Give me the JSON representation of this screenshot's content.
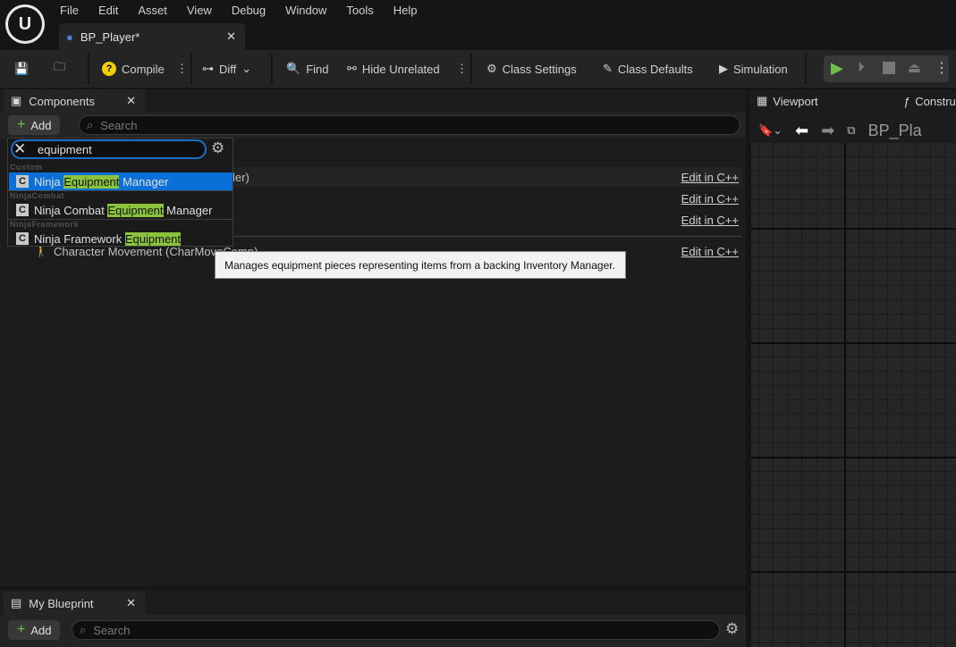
{
  "menu": [
    "File",
    "Edit",
    "Asset",
    "View",
    "Debug",
    "Window",
    "Tools",
    "Help"
  ],
  "document_tab": {
    "title": "BP_Player*"
  },
  "toolbar": {
    "compile": "Compile",
    "diff": "Diff",
    "find": "Find",
    "hide_unrelated": "Hide Unrelated",
    "class_settings": "Class Settings",
    "class_defaults": "Class Defaults",
    "simulation": "Simulation"
  },
  "components": {
    "title": "Components",
    "add": "Add",
    "search_placeholder": "Search",
    "rows": [
      {
        "label": "ler)",
        "action": "Edit in C++"
      },
      {
        "label": "",
        "action": "Edit in C++"
      },
      {
        "label": "",
        "action": "Edit in C++"
      },
      {
        "label": "Character Movement (CharMoveComp)",
        "action": "Edit in C++"
      }
    ]
  },
  "add_dropdown": {
    "query": "equipment",
    "groups": [
      {
        "category": "Custom",
        "items": [
          {
            "pre": "Ninja ",
            "match": "Equipment",
            "post": " Manager",
            "selected": true
          }
        ]
      },
      {
        "category": "NinjaCombat",
        "items": [
          {
            "pre": "Ninja Combat ",
            "match": "Equipment",
            "post": " Manager"
          }
        ]
      },
      {
        "category": "NinjaFramework",
        "items": [
          {
            "pre": "Ninja Framework ",
            "match": "Equipment",
            "post": ""
          }
        ]
      }
    ]
  },
  "tooltip": "Manages equipment pieces representing items from a backing Inventory Manager.",
  "my_blueprint": {
    "title": "My Blueprint",
    "add": "Add",
    "search_placeholder": "Search"
  },
  "viewport": {
    "tab_viewport": "Viewport",
    "tab_construction": "Constru",
    "breadcrumb": "BP_Pla"
  },
  "colors": {
    "accent": "#0a70d8",
    "highlight": "#8bc43c",
    "play": "#6cc04a"
  }
}
